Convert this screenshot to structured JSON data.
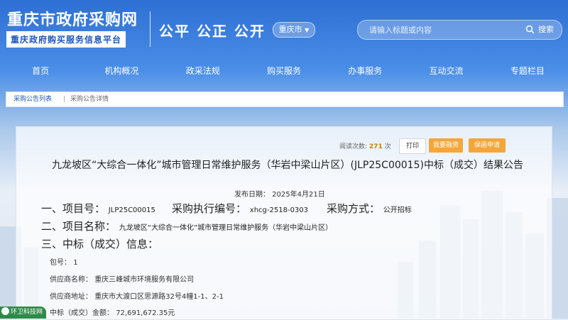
{
  "header": {
    "site_title": "重庆市政府采购网",
    "site_subtitle": "重庆政府购买服务信息平台",
    "slogan": "公平 公正 公开",
    "region_selector": "重庆市",
    "search_placeholder": "请输入标题或内容",
    "search_button": "搜索"
  },
  "nav": {
    "items": [
      {
        "label": "首页"
      },
      {
        "label": "机构概况"
      },
      {
        "label": "政采法规"
      },
      {
        "label": "购买服务"
      },
      {
        "label": "办事服务"
      },
      {
        "label": "互动交流"
      },
      {
        "label": "专题栏目"
      }
    ]
  },
  "breadcrumb": {
    "list_link": "采购公告列表",
    "separator": "|",
    "current": "采购公告详情"
  },
  "toolbar": {
    "read_label": "阅读次数:",
    "read_count": "271",
    "read_unit": "次",
    "print_label": "打印",
    "bid_label": "我要融资",
    "bond_label": "保函申请"
  },
  "notice": {
    "title": "九龙坡区“大综合一体化”城市管理日常维护服务（华岩中梁山片区）(JLP25C00015)中标（成交）结果公告",
    "publish_date": "发布日期： 2025年4月21日",
    "section1": {
      "project_no_label": "一、项目号：",
      "project_no": "JLP25C00015",
      "exec_no_label": "采购执行编号：",
      "exec_no": "xhcg-2518-0303",
      "method_label": "采购方式：",
      "method": "公开招标"
    },
    "section2": {
      "label": "二、项目名称：",
      "value": "九龙坡区“大综合一体化”城市管理日常维护服务（华岩中梁山片区）"
    },
    "section3": {
      "label": "三、中标（成交）信息："
    },
    "details": [
      {
        "label": "包号：",
        "value": "1"
      },
      {
        "label": "供应商名称：",
        "value": "重庆三峰城市环境服务有限公司"
      },
      {
        "label": "供应商地址：",
        "value": "重庆市大渡口区思源路32号4幢1-1、2-1"
      },
      {
        "label": "中标（成交）金额：",
        "value": "72,691,672.35元"
      }
    ]
  },
  "watermark_badge": "环卫科技网",
  "colors": {
    "brand_blue": "#2e6fd3",
    "accent_orange": "#f4a63a",
    "badge_green": "#2f8a4a"
  }
}
